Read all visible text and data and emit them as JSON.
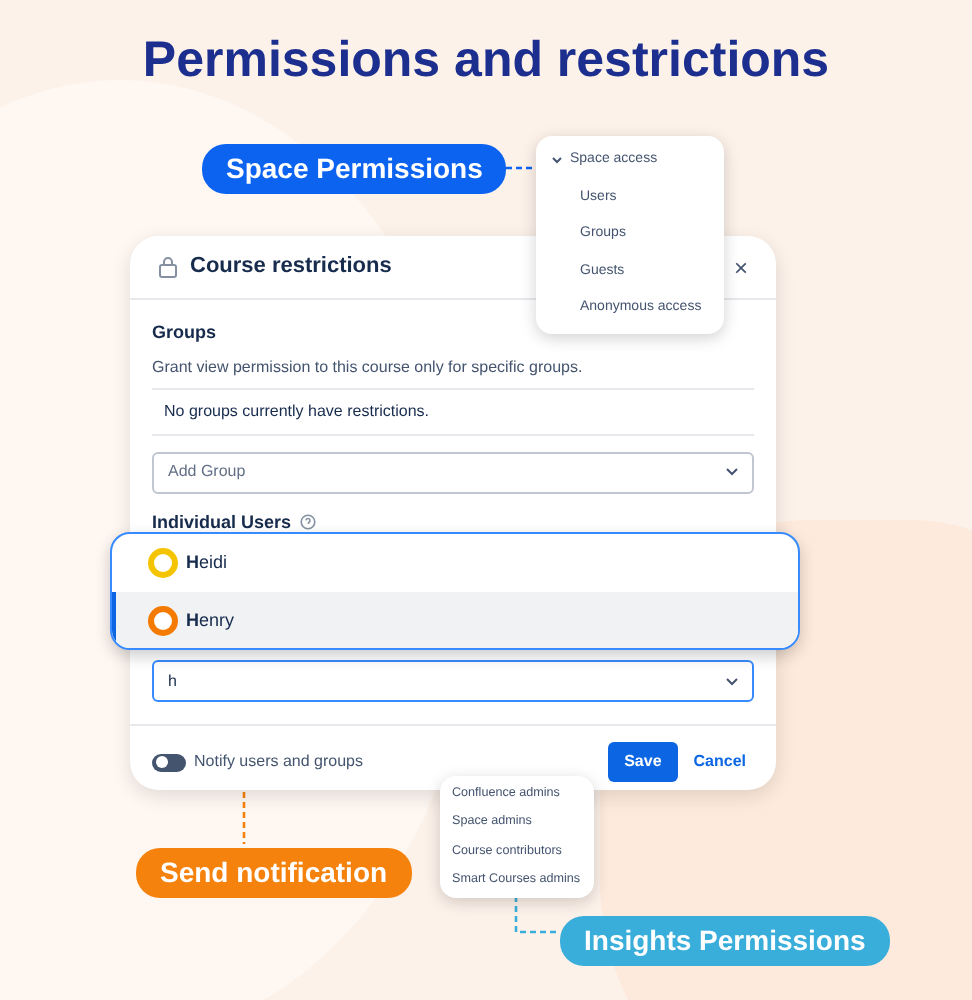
{
  "title": "Permissions and restrictions",
  "callouts": [
    {
      "label": "Space Permissions",
      "color": "#0b63f0"
    },
    {
      "label": "Send notification",
      "color": "#f5820d"
    },
    {
      "label": "Insights Permissions",
      "color": "#3aaedb"
    }
  ],
  "space_access_menu": {
    "header": "Space access",
    "expanded": true,
    "items": [
      "Users",
      "Groups",
      "Guests",
      "Anonymous access"
    ]
  },
  "dialog": {
    "title": "Course restrictions",
    "close": "×",
    "groups_heading": "Groups",
    "groups_description": "Grant view permission to this course only for specific groups.",
    "groups_empty": "No groups currently have restrictions.",
    "group_select": {
      "placeholder": "Add Group"
    },
    "users_heading": "Individual Users",
    "user_search": {
      "value": "h"
    },
    "notify": {
      "label": "Notify users and groups",
      "on": false
    },
    "buttons": [
      {
        "label": "Save",
        "kind": "primary"
      },
      {
        "label": "Cancel",
        "kind": "link"
      }
    ]
  },
  "user_suggestions": [
    {
      "name": "**H**eidi",
      "selected": false,
      "color": "#f5c400"
    },
    {
      "name": "**H**enry",
      "selected": true,
      "color": "#f57a00"
    }
  ],
  "insights_menu": {
    "items": [
      "Confluence admins",
      "Space admins",
      "Course contributors",
      "Smart Courses admins"
    ]
  }
}
